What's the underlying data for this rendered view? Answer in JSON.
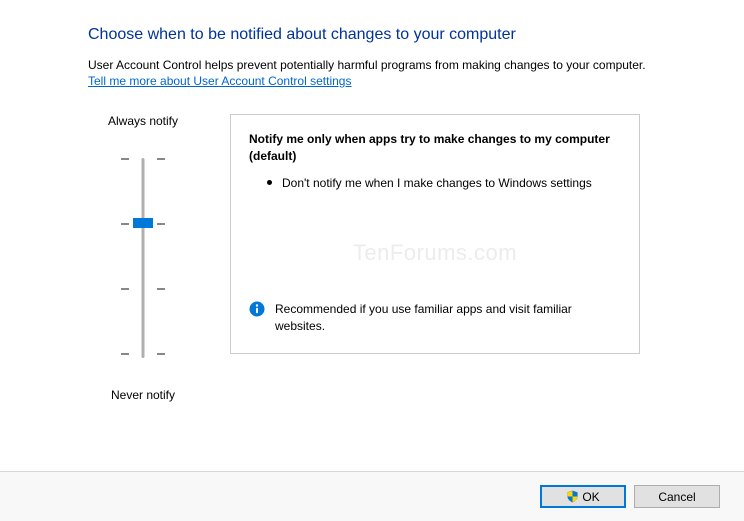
{
  "title": "Choose when to be notified about changes to your computer",
  "description": "User Account Control helps prevent potentially harmful programs from making changes to your computer.",
  "link_text": "Tell me more about User Account Control settings",
  "slider": {
    "top_label": "Always notify",
    "bottom_label": "Never notify",
    "levels": 4,
    "current_level": 2
  },
  "info": {
    "heading": "Notify me only when apps try to make changes to my computer (default)",
    "bullet": "Don't notify me when I make changes to Windows settings",
    "recommendation": "Recommended if you use familiar apps and visit familiar websites."
  },
  "watermark": "TenForums.com",
  "buttons": {
    "ok": "OK",
    "cancel": "Cancel"
  }
}
